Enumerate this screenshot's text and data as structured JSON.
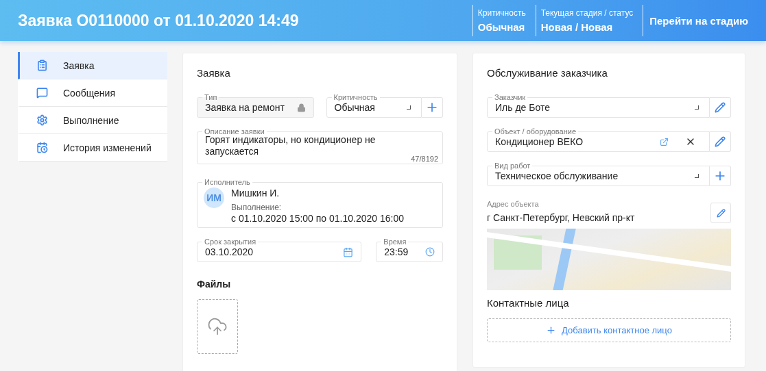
{
  "header": {
    "title": "Заявка О0110000 от 01.10.2020 14:49",
    "meta": [
      {
        "label": "Критичность",
        "value": "Обычная"
      },
      {
        "label": "Текущая стадия / статус",
        "value": "Новая / Новая"
      }
    ],
    "action": "Перейти на стадию"
  },
  "sidebar": {
    "items": [
      {
        "label": "Заявка",
        "selected": true
      },
      {
        "label": "Сообщения",
        "selected": false
      },
      {
        "label": "Выполнение",
        "selected": false
      },
      {
        "label": "История изменений",
        "selected": false
      }
    ]
  },
  "request_card": {
    "title": "Заявка",
    "type_field": {
      "label": "Тип",
      "value": "Заявка на ремонт",
      "locked": true
    },
    "criticality_field": {
      "label": "Критичность",
      "value": "Обычная"
    },
    "description_field": {
      "label": "Описание заявки",
      "value": "Горят индикаторы, но кондиционер не запускается",
      "counter": "47/8192"
    },
    "executor": {
      "label": "Исполнитель",
      "initials": "ИМ",
      "name": "Мишкин И.",
      "period_label": "Выполнение:",
      "period": "с 01.10.2020 15:00 по 01.10.2020 16:00"
    },
    "due_date": {
      "label": "Срок закрытия",
      "value": "03.10.2020"
    },
    "due_time": {
      "label": "Время",
      "value": "23:59"
    },
    "files_title": "Файлы"
  },
  "customer_card": {
    "title": "Обслуживание заказчика",
    "fields": [
      {
        "kind": "lookup",
        "label": "Заказчик",
        "value": "Иль де Боте"
      },
      {
        "kind": "object",
        "label": "Объект / оборудование",
        "value": "Кондиционер ВЕКО"
      },
      {
        "kind": "select",
        "label": "Вид работ",
        "value": "Техническое обслуживание"
      }
    ],
    "address": {
      "label": "Адрес объекта",
      "value": "г Санкт-Петербург, Невский пр-кт"
    },
    "contacts_title": "Контактные лица",
    "add_contact": "Добавить контактное лицо"
  }
}
